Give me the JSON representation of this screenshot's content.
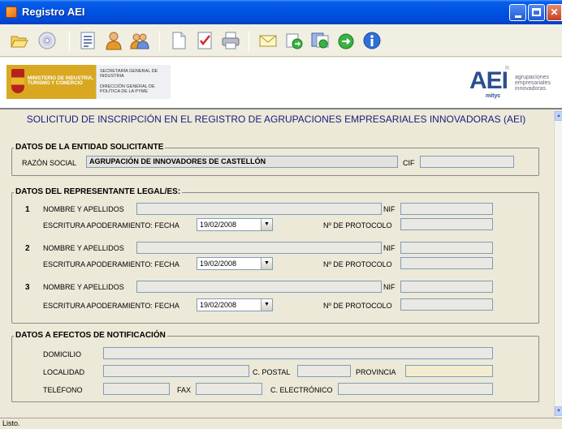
{
  "window": {
    "title": "Registro AEI"
  },
  "toolbar": {
    "icons": [
      "open-folder-icon",
      "cd-icon",
      "document-list-icon",
      "user-icon",
      "users-icon",
      "new-document-icon",
      "checklist-icon",
      "printer-icon",
      "envelope-icon",
      "export-icon",
      "send-icon",
      "reply-icon",
      "info-icon"
    ]
  },
  "header": {
    "ministry": "MINISTERIO DE INDUSTRIA, TURISMO Y COMERCIO",
    "secretaria": "SECRETARÍA GENERAL DE INDUSTRIA",
    "direccion": "DIRECCIÓN GENERAL DE POLÍTICA DE LA PYME",
    "aei_logo": "AEI",
    "aei_logo_r": "R",
    "mityc": "mityc",
    "aei_tag": "agrupaciones empresariales innovadoras"
  },
  "form": {
    "title": "SOLICITUD DE INSCRIPCIÓN EN EL REGISTRO DE AGRUPACIONES EMPRESARIALES INNOVADORAS (AEI)",
    "entidad": {
      "legend": "DATOS DE LA ENTIDAD SOLICITANTE",
      "razon_label": "RAZÓN SOCIAL",
      "razon_value": "AGRUPACIÓN DE INNOVADORES DE CASTELLÓN",
      "cif_label": "CIF",
      "cif_value": ""
    },
    "representantes": {
      "legend": "DATOS DEL REPRESENTANTE LEGAL/ES:",
      "nombre_label": "NOMBRE Y APELLIDOS",
      "nif_label": "NIF",
      "escritura_label": "ESCRITURA APODERAMIENTO: FECHA",
      "protocolo_label": "Nº DE PROTOCOLO",
      "rows": [
        {
          "num": "1",
          "fecha": "19/02/2008"
        },
        {
          "num": "2",
          "fecha": "19/02/2008"
        },
        {
          "num": "3",
          "fecha": "19/02/2008"
        }
      ]
    },
    "notificacion": {
      "legend": "DATOS A EFECTOS DE NOTIFICACIÓN",
      "domicilio_label": "DOMICILIO",
      "localidad_label": "LOCALIDAD",
      "cpostal_label": "C. POSTAL",
      "provincia_label": "PROVINCIA",
      "telefono_label": "TELÉFONO",
      "fax_label": "FAX",
      "email_label": "C. ELECTRÓNICO"
    }
  },
  "status": {
    "text": "Listo."
  }
}
